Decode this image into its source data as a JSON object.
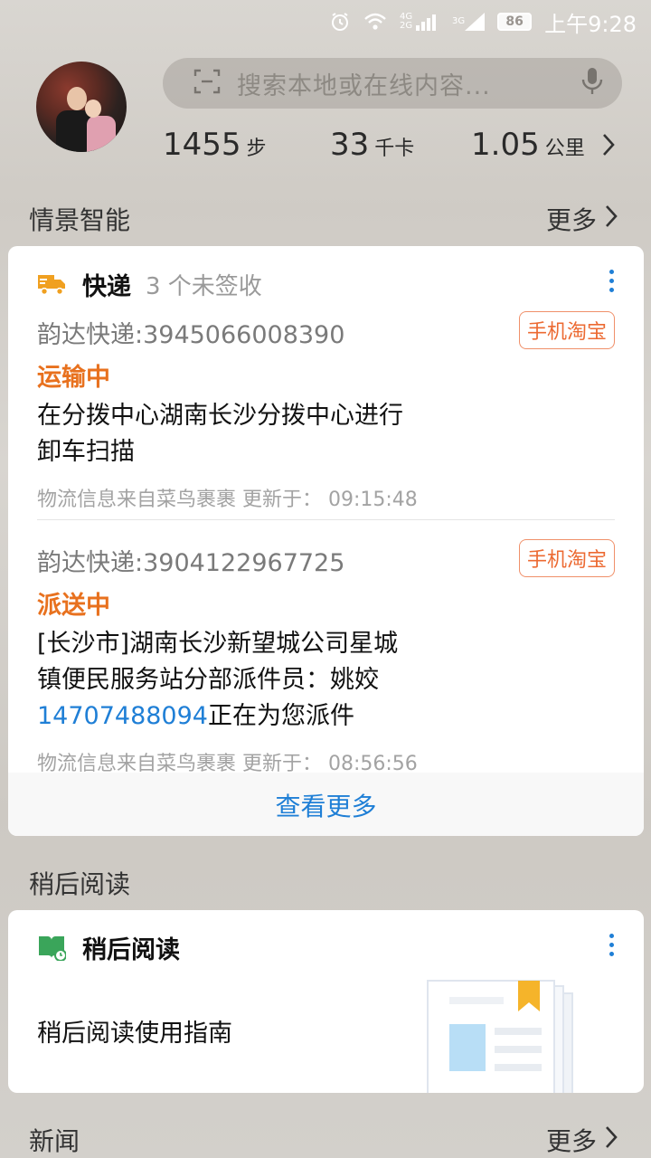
{
  "status_bar": {
    "network": "4G 2G",
    "network2": "3G",
    "battery": "86",
    "time": "上午9:28"
  },
  "search": {
    "placeholder": "搜索本地或在线内容..."
  },
  "stats": [
    {
      "value": "1455",
      "unit": "步"
    },
    {
      "value": "33",
      "unit": "千卡"
    },
    {
      "value": "1.05",
      "unit": "公里"
    }
  ],
  "sections": {
    "smart": {
      "title": "情景智能",
      "more": "更多"
    },
    "read_later": {
      "title": "稍后阅读"
    },
    "news": {
      "title": "新闻",
      "more": "更多"
    }
  },
  "express_card": {
    "title": "快递",
    "subtitle": "3 个未签收",
    "view_more": "查看更多",
    "packages": [
      {
        "company": "韵达快递:3945066008390",
        "source": "手机淘宝",
        "status": "运输中",
        "detail_line1": "在分拨中心湖南长沙分拨中心进行",
        "detail_line2": "卸车扫描",
        "meta": "物流信息来自菜鸟裹裹  更新于： 09:15:48"
      },
      {
        "company": "韵达快递:3904122967725",
        "source": "手机淘宝",
        "status": "派送中",
        "detail_line1": "[长沙市]湖南长沙新望城公司星城",
        "detail_line2": "镇便民服务站分部派件员：姚姣",
        "phone": "14707488094",
        "detail_line3": "正在为您派件",
        "meta": "物流信息来自菜鸟裹裹  更新于： 08:56:56"
      }
    ]
  },
  "read_card": {
    "title": "稍后阅读",
    "guide": "稍后阅读使用指南"
  },
  "colors": {
    "accent_blue": "#1f7fd6",
    "accent_orange": "#e8711e"
  }
}
